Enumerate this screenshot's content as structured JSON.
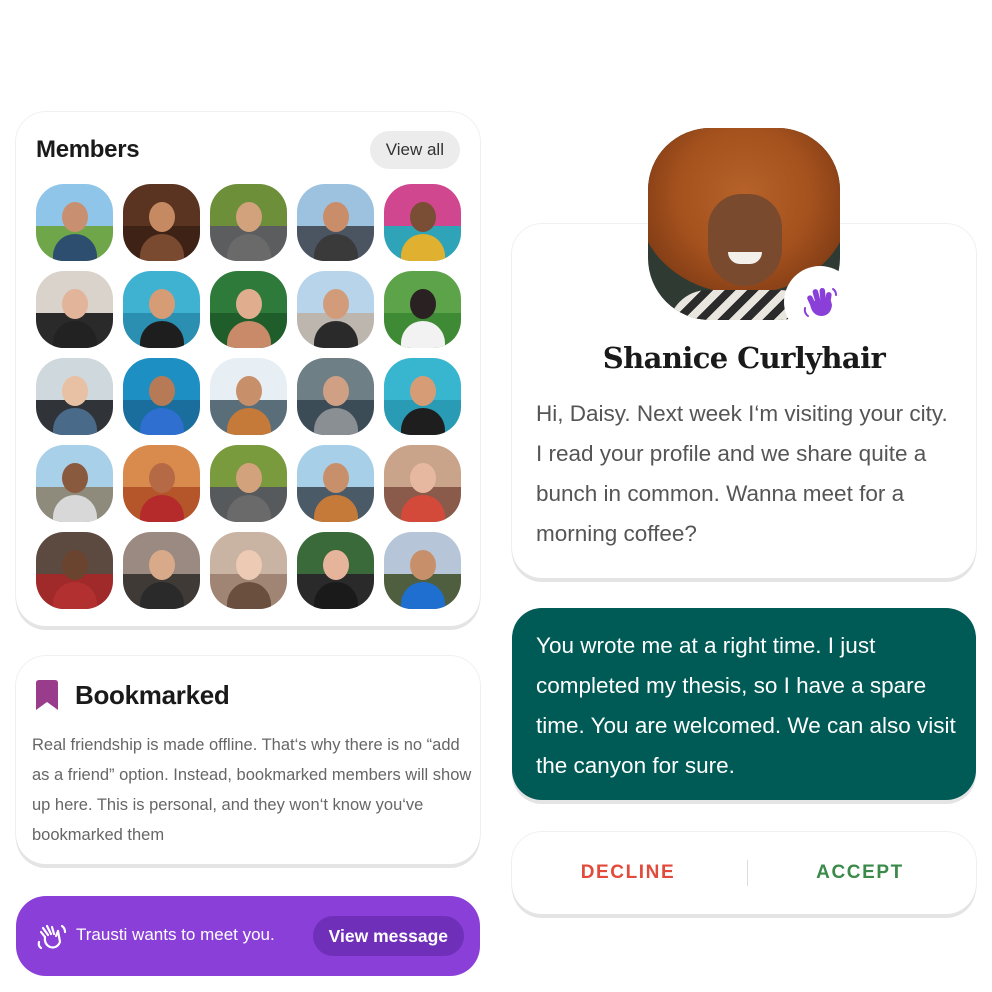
{
  "members": {
    "title": "Members",
    "view_all_label": "View all",
    "avatars": [
      {
        "sky": "#8fc5e8",
        "ground": "#6fa64a",
        "skin": "#c89070",
        "shirt": "#2d4e6e"
      },
      {
        "sky": "#5a3420",
        "ground": "#3d2215",
        "skin": "#c58a62",
        "shirt": "#7a4a30"
      },
      {
        "sky": "#6d8f3a",
        "ground": "#5b5d5e",
        "skin": "#d1a27c",
        "shirt": "#6a6a6a"
      },
      {
        "sky": "#9cc2e0",
        "ground": "#4b5562",
        "skin": "#c98d6a",
        "shirt": "#3a3a3a"
      },
      {
        "sky": "#d0478f",
        "ground": "#2fa3b8",
        "skin": "#7a4e34",
        "shirt": "#e0b030"
      },
      {
        "sky": "#d9d3cc",
        "ground": "#2a2a2a",
        "skin": "#e2b49a",
        "shirt": "#222222"
      },
      {
        "sky": "#3fb2d2",
        "ground": "#2a8fb0",
        "skin": "#d59c76",
        "shirt": "#1e1e1e"
      },
      {
        "sky": "#2e7a3a",
        "ground": "#1f5e2a",
        "skin": "#e0ae8e",
        "shirt": "#c98a6a"
      },
      {
        "sky": "#b8d4ea",
        "ground": "#bcb6ae",
        "skin": "#d29c7a",
        "shirt": "#2a2a2a"
      },
      {
        "sky": "#5da34a",
        "ground": "#3f8a34",
        "skin": "#2a2222",
        "shirt": "#f2f2f2"
      },
      {
        "sky": "#cfd8dc",
        "ground": "#303438",
        "skin": "#e8c0a4",
        "shirt": "#4a6a8a"
      },
      {
        "sky": "#1d8fc2",
        "ground": "#1a6e9e",
        "skin": "#b77a56",
        "shirt": "#2f6fd0"
      },
      {
        "sky": "#e7eff5",
        "ground": "#5a6e7a",
        "skin": "#c8906a",
        "shirt": "#c57a3a"
      },
      {
        "sky": "#6f7f86",
        "ground": "#3b4c57",
        "skin": "#d0a084",
        "shirt": "#8a8f94"
      },
      {
        "sky": "#38b6cf",
        "ground": "#2a9bb4",
        "skin": "#d59c76",
        "shirt": "#1e1e1e"
      },
      {
        "sky": "#a8d0e8",
        "ground": "#8e8a7c",
        "skin": "#8a5a3e",
        "shirt": "#d8d8d8"
      },
      {
        "sky": "#d98b4e",
        "ground": "#b4562a",
        "skin": "#b56a45",
        "shirt": "#b52a2a"
      },
      {
        "sky": "#7a9a3e",
        "ground": "#575a5c",
        "skin": "#d1a27c",
        "shirt": "#6a6a6a"
      },
      {
        "sky": "#a7cfe8",
        "ground": "#4a5a66",
        "skin": "#c8906a",
        "shirt": "#c57a3a"
      },
      {
        "sky": "#c9a48a",
        "ground": "#8a5a4a",
        "skin": "#e6b8a0",
        "shirt": "#d44a3a"
      },
      {
        "sky": "#5c4a40",
        "ground": "#a02a2a",
        "skin": "#6b4430",
        "shirt": "#b33030"
      },
      {
        "sky": "#9a8a82",
        "ground": "#403a36",
        "skin": "#d9aa8a",
        "shirt": "#2a2a2a"
      },
      {
        "sky": "#c9b4a4",
        "ground": "#a08474",
        "skin": "#eccab4",
        "shirt": "#6a4e3e"
      },
      {
        "sky": "#3a6a3a",
        "ground": "#2a2a2a",
        "skin": "#e6b49a",
        "shirt": "#1a1a1a"
      },
      {
        "sky": "#b6c6d8",
        "ground": "#4e5e3e",
        "skin": "#c8906a",
        "shirt": "#1e6fd0"
      }
    ]
  },
  "bookmarked": {
    "title": "Bookmarked",
    "text": "Real friendship is made offline. That‘s why there is no “add as a friend” option. Instead, bookmarked members will show up here. This is personal, and they won‘t know you‘ve bookmarked them",
    "icon": "bookmark-icon",
    "icon_color": "#9a3c8c"
  },
  "notification": {
    "text": "Trausti wants to meet you.",
    "button_label": "View message",
    "icon": "wave-hand-icon",
    "color": "#8a3fd8"
  },
  "profile": {
    "name": "Shanice Curlyhair",
    "message": "Hi, Daisy. Next week I‘m visiting your city. I read your profile and we share quite a bunch in common. Wanna meet for a morning coffee?",
    "badge_icon": "wave-hand-icon",
    "badge_color": "#8a3fd8"
  },
  "reply": {
    "text": "You wrote me at a right time. I just completed my thesis, so I have a spare time. You are welcomed. We can also visit the canyon for sure.",
    "color": "#005b56"
  },
  "actions": {
    "decline_label": "DECLINE",
    "accept_label": "ACCEPT",
    "decline_color": "#e24a3b",
    "accept_color": "#3b8a4a"
  }
}
